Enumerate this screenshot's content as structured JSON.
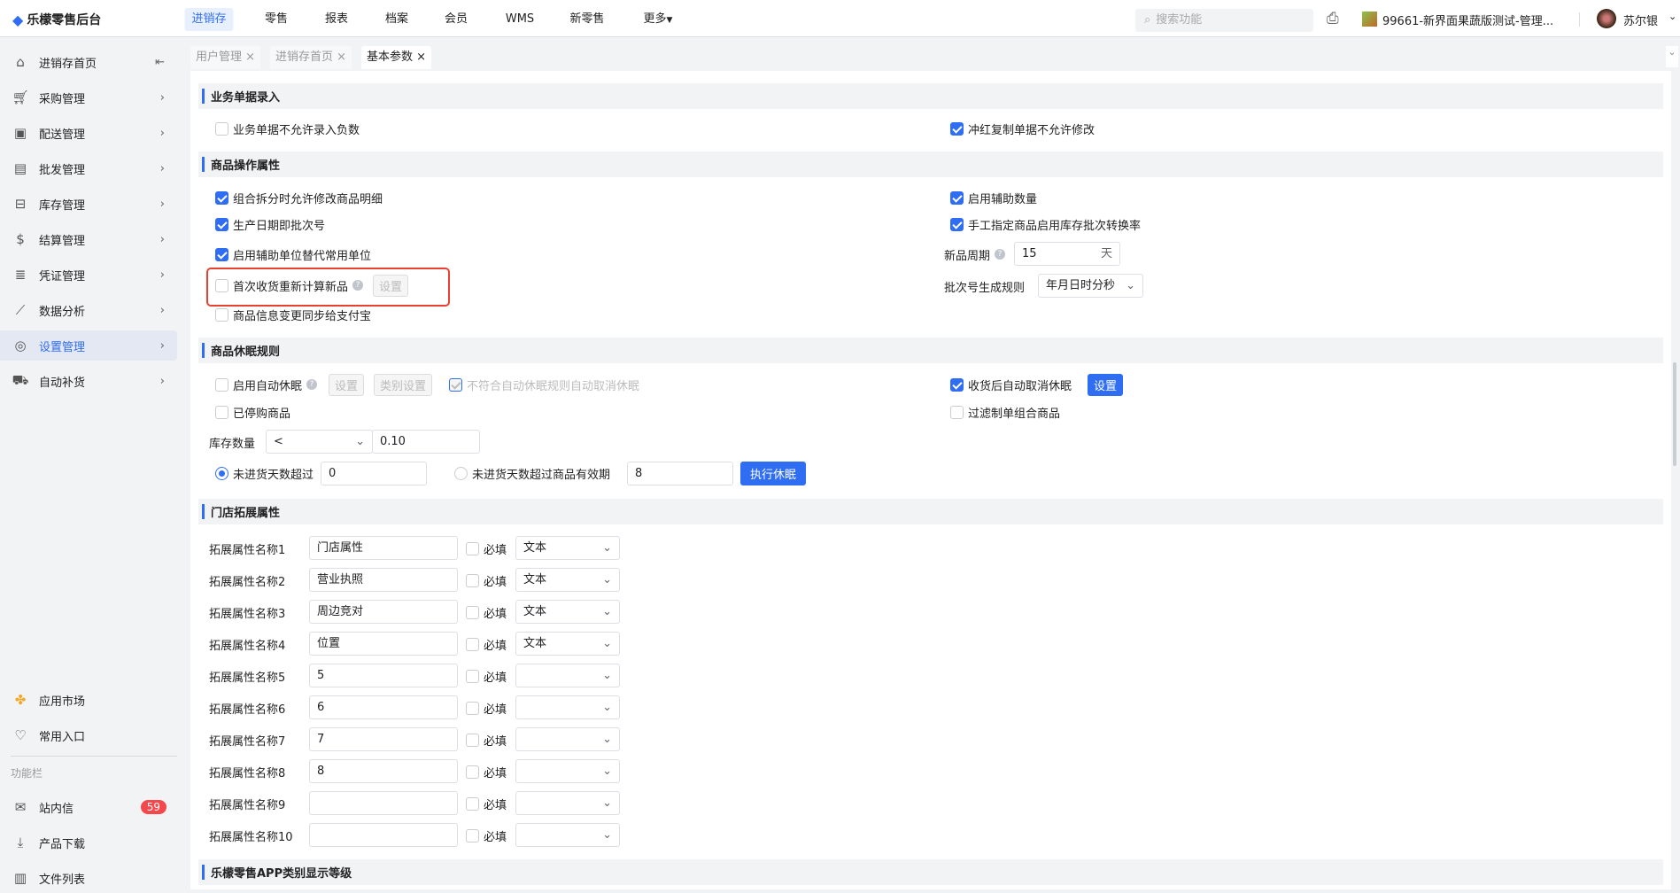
{
  "header": {
    "logo": "乐檬零售后台",
    "nav": [
      "进销存",
      "零售",
      "报表",
      "档案",
      "会员",
      "WMS",
      "新零售",
      "更多"
    ],
    "active_nav": 0,
    "search_placeholder": "搜索功能",
    "store": "99661-新界面果蔬版测试-管理...",
    "user": "苏尔银"
  },
  "sidebar": {
    "items": [
      {
        "label": "进销存首页",
        "icon": "home-icon"
      },
      {
        "label": "采购管理",
        "icon": "cart-icon"
      },
      {
        "label": "配送管理",
        "icon": "delivery-icon"
      },
      {
        "label": "批发管理",
        "icon": "wholesale-icon"
      },
      {
        "label": "库存管理",
        "icon": "inventory-icon"
      },
      {
        "label": "结算管理",
        "icon": "settlement-icon"
      },
      {
        "label": "凭证管理",
        "icon": "voucher-icon"
      },
      {
        "label": "数据分析",
        "icon": "chart-icon"
      },
      {
        "label": "设置管理",
        "icon": "settings-icon"
      },
      {
        "label": "自动补货",
        "icon": "replenish-icon"
      }
    ],
    "active": 8,
    "bottom": {
      "app_market": "应用市场",
      "favorites": "常用入口",
      "section": "功能栏",
      "messages": "站内信",
      "messages_count": "59",
      "download": "产品下载",
      "files": "文件列表"
    }
  },
  "tabs": [
    "用户管理",
    "进销存首页",
    "基本参数"
  ],
  "active_tab": 2,
  "sections": {
    "s1": {
      "title": "业务单据录入",
      "left": {
        "label": "业务单据不允许录入负数",
        "checked": false
      },
      "right": {
        "label": "冲红复制单据不允许修改",
        "checked": true
      }
    },
    "s2": {
      "title": "商品操作属性",
      "left": [
        {
          "label": "组合拆分时允许修改商品明细",
          "checked": true
        },
        {
          "label": "生产日期即批次号",
          "checked": true
        },
        {
          "label": "启用辅助单位替代常用单位",
          "checked": true
        },
        {
          "label": "首次收货重新计算新品",
          "checked": false,
          "button": "设置"
        },
        {
          "label": "商品信息变更同步给支付宝",
          "checked": false
        }
      ],
      "right": [
        {
          "label": "启用辅助数量",
          "checked": true
        },
        {
          "label": "手工指定商品启用库存批次转换率",
          "checked": true
        }
      ],
      "new_period_label": "新品周期",
      "new_period_value": "15",
      "new_period_unit": "天",
      "batch_rule_label": "批次号生成规则",
      "batch_rule_value": "年月日时分秒"
    },
    "s3": {
      "title": "商品休眠规则",
      "auto_sleep": "启用自动休眠",
      "btn_set": "设置",
      "btn_category": "类别设置",
      "auto_cancel": "不符合自动休眠规则自动取消休眠",
      "stopped": "已停购商品",
      "stock_label": "库存数量",
      "stock_op": "<",
      "stock_value": "0.10",
      "radio1": "未进货天数超过",
      "radio1_value": "0",
      "radio2": "未进货天数超过商品有效期",
      "radio2_value": "8",
      "execute": "执行休眠",
      "recv_cancel": "收货后自动取消休眠",
      "recv_btn": "设置",
      "filter_combo": "过滤制单组合商品"
    },
    "s4": {
      "title": "门店拓展属性",
      "required": "必填",
      "rows": [
        {
          "label": "拓展属性名称1",
          "value": "门店属性",
          "type": "文本"
        },
        {
          "label": "拓展属性名称2",
          "value": "营业执照",
          "type": "文本"
        },
        {
          "label": "拓展属性名称3",
          "value": "周边竞对",
          "type": "文本"
        },
        {
          "label": "拓展属性名称4",
          "value": "位置",
          "type": "文本"
        },
        {
          "label": "拓展属性名称5",
          "value": "5",
          "type": ""
        },
        {
          "label": "拓展属性名称6",
          "value": "6",
          "type": ""
        },
        {
          "label": "拓展属性名称7",
          "value": "7",
          "type": ""
        },
        {
          "label": "拓展属性名称8",
          "value": "8",
          "type": ""
        },
        {
          "label": "拓展属性名称9",
          "value": "",
          "type": ""
        },
        {
          "label": "拓展属性名称10",
          "value": "",
          "type": ""
        }
      ]
    },
    "s5": {
      "title": "乐檬零售APP类别显示等级"
    }
  }
}
